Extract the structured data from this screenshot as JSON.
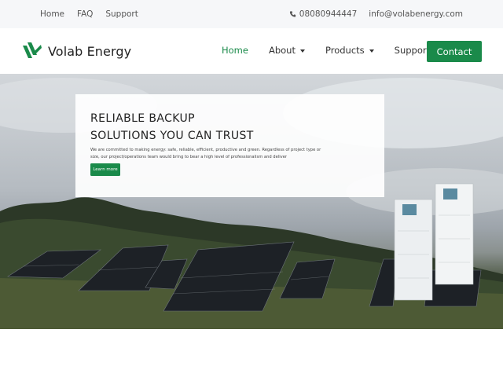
{
  "topbar": {
    "links": [
      "Home",
      "FAQ",
      "Support"
    ],
    "phone": "08080944447",
    "email": "info@volabenergy.com"
  },
  "brand": {
    "name": "Volab Energy",
    "color": "#1a8a4a"
  },
  "nav": {
    "home": "Home",
    "about": "About",
    "products": "Products",
    "support": "Support",
    "contact": "Contact"
  },
  "hero": {
    "title_line1": "RELIABLE BACKUP",
    "title_line2": "SOLUTIONS YOU CAN TRUST",
    "description": "We are committed to making energy: safe, reliable, efficient, productive and green. Regardless of project type or size, our project/operations team would bring to bear a high level of professionalism and deliver",
    "button": "Learn more"
  },
  "icons": {
    "phone": "phone-icon",
    "logo": "volab-logo-icon",
    "dropdown": "chevron-down-icon"
  }
}
